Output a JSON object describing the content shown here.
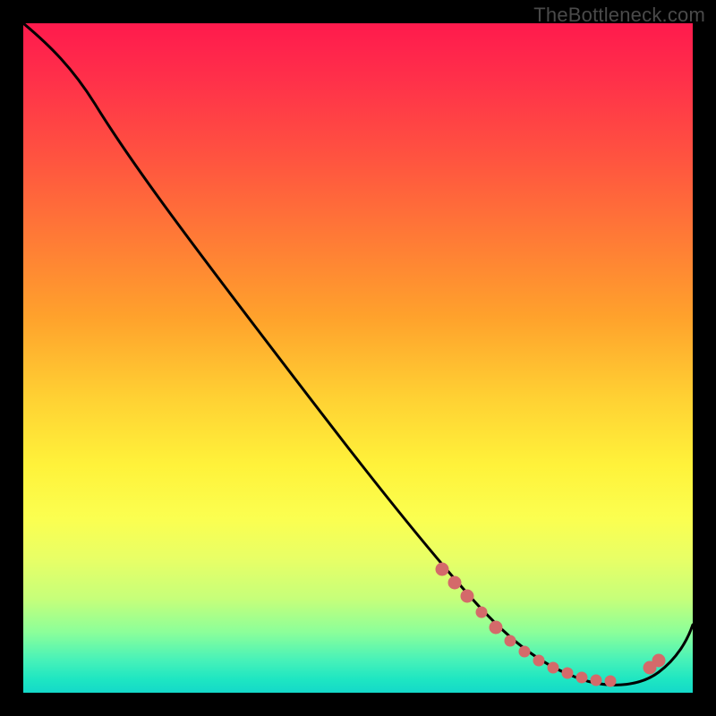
{
  "watermark": "TheBottleneck.com",
  "chart_data": {
    "type": "line",
    "title": "",
    "xlabel": "",
    "ylabel": "",
    "xlim": [
      0,
      100
    ],
    "ylim": [
      0,
      100
    ],
    "grid": false,
    "legend": false,
    "series": [
      {
        "name": "curve",
        "color": "#000000",
        "x": [
          0,
          5,
          10,
          18,
          28,
          38,
          48,
          58,
          66,
          72,
          78,
          82,
          86,
          90,
          94,
          100
        ],
        "y": [
          100,
          96,
          91,
          82,
          70,
          58,
          46,
          34,
          24,
          16,
          9,
          5,
          2,
          1,
          3,
          10
        ]
      }
    ],
    "markers": {
      "name": "highlight-dots",
      "color": "#d46a6a",
      "x": [
        62,
        64,
        66,
        70,
        72,
        74,
        76,
        78,
        80,
        82,
        84,
        86,
        88,
        93,
        94
      ],
      "y": [
        26,
        23,
        20,
        13,
        10,
        8,
        6,
        5,
        4,
        3,
        2,
        2,
        2,
        5,
        6
      ]
    },
    "gradient_stops": [
      {
        "pos": 0,
        "color": "#ff1a4d"
      },
      {
        "pos": 20,
        "color": "#ff5340"
      },
      {
        "pos": 44,
        "color": "#ffa22c"
      },
      {
        "pos": 66,
        "color": "#fff23a"
      },
      {
        "pos": 86,
        "color": "#c6ff7a"
      },
      {
        "pos": 100,
        "color": "#14d9c9"
      }
    ]
  }
}
